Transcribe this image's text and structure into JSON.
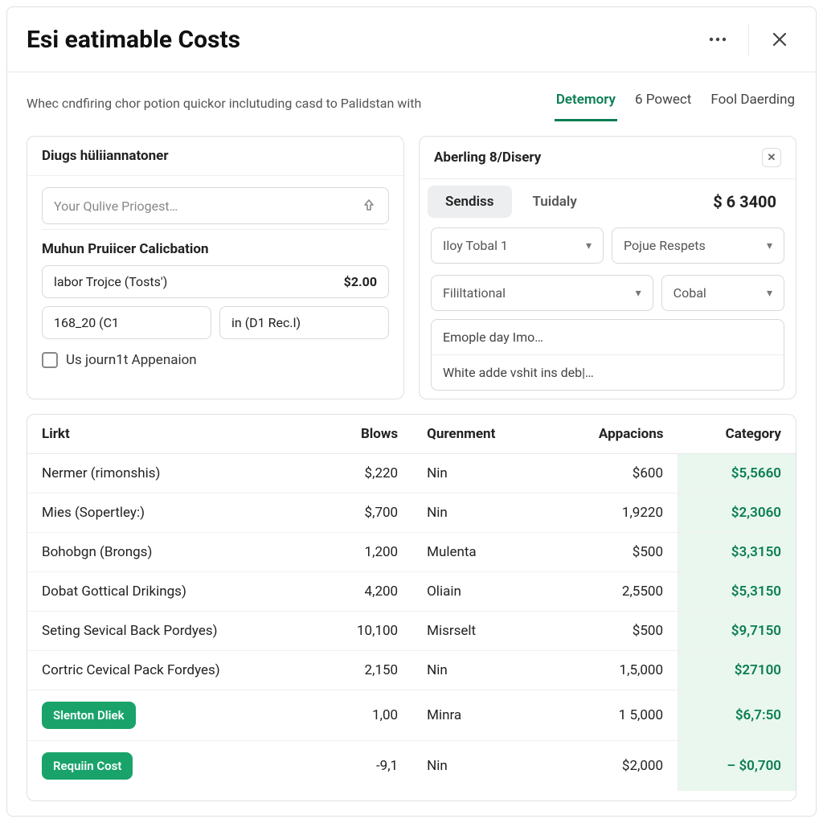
{
  "modal": {
    "title": "Esi eatimable Costs",
    "subtitle": "Whec cndfiring chor potion quickor inclutuding casd to Palidstan with"
  },
  "tabs": {
    "items": [
      "Detemory",
      "6 Powect",
      "Fool Daerding"
    ],
    "active": 0
  },
  "left_panel": {
    "title": "Diugs hüliiannatoner",
    "search_placeholder": "Your Qulive Priogest…",
    "calc_title": "Muhun Pruiicer Calicbation",
    "labor_label": "labor Trojce (Tosts')",
    "labor_value": "$2.00",
    "field_a": "168_20 (C1",
    "field_b": "in (D1  Rec.l)",
    "checkbox_label": "Us journ1t Appenaion"
  },
  "right_panel": {
    "title": "Aberling 8/Disery",
    "tab_a": "Sendiss",
    "tab_b": "Tuidaly",
    "amount": "$ 6 3400",
    "select_1": "Iloy Tobal 1",
    "select_2": "Pojue Respets",
    "select_3": "Fililtational",
    "select_4": "Cobal",
    "row_1": "Emople day Imo…",
    "row_2": "White adde vshit ins deb|…"
  },
  "table": {
    "headers": [
      "Lirkt",
      "Blows",
      "Qurenment",
      "Appacions",
      "Category"
    ],
    "rows": [
      {
        "c0": "Nermer (rimonshis)",
        "c1": "$,220",
        "c2": "Nin",
        "c3": "$600",
        "c4": "$5,5660"
      },
      {
        "c0": "Mies (Sopertley:)",
        "c1": "$,700",
        "c2": "Nin",
        "c3": "1,9220",
        "c4": "$2,3060"
      },
      {
        "c0": "Bohobgn (Brongs)",
        "c1": "1,200",
        "c2": "Mulenta",
        "c3": "$500",
        "c4": "$3,3150"
      },
      {
        "c0": "Dobat Gottical Drikings)",
        "c1": "4,200",
        "c2": "Oliain",
        "c3": "2,5500",
        "c4": "$5,3150"
      },
      {
        "c0": "Seting Sevical Back Pordyes)",
        "c1": "10,100",
        "c2": "Misrselt",
        "c3": "$500",
        "c4": "$9,7150"
      },
      {
        "c0": "Cortric Cevical Pack Fordyes)",
        "c1": "2,150",
        "c2": "Nin",
        "c3": "1,5,000",
        "c4": "$27100"
      },
      {
        "c0_badge": "Slenton Dliek",
        "c1": "1,00",
        "c2": "Minra",
        "c3": "1 5,000",
        "c4": "$6,7:50"
      },
      {
        "c0_badge": "Requiin Cost",
        "c1": "-9,1",
        "c2": "Nin",
        "c3": "$2,000",
        "c4": "–  $0,700"
      }
    ]
  }
}
